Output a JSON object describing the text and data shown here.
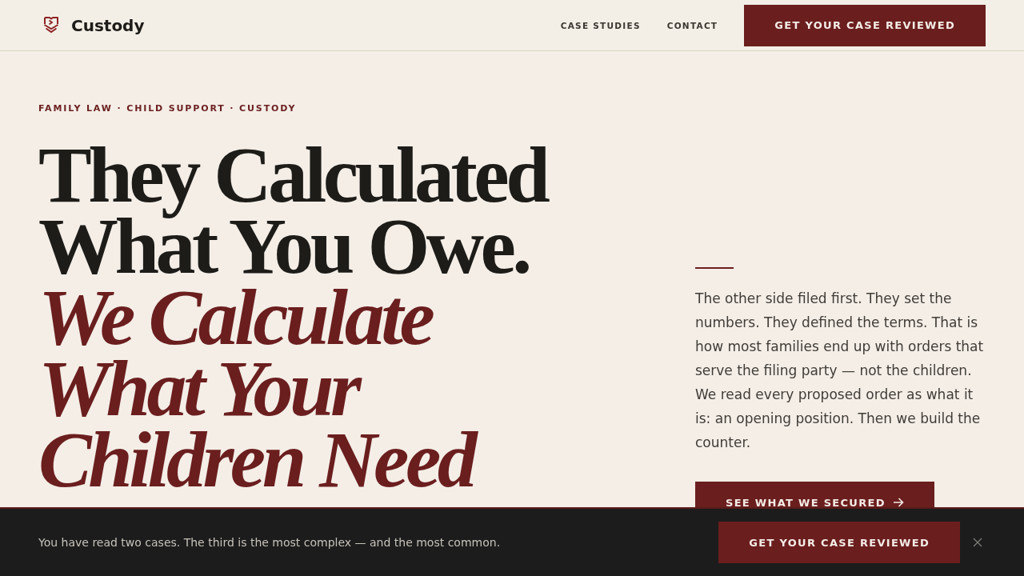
{
  "header": {
    "logo": "Custody",
    "nav": [
      {
        "label": "CASE STUDIES"
      },
      {
        "label": "CONTACT"
      }
    ],
    "cta": "GET YOUR CASE REVIEWED"
  },
  "hero": {
    "eyebrow": "FAMILY LAW · CHILD SUPPORT · CUSTODY",
    "headline": "They Calculated What You Owe. *We Calculate What Your Children Need*",
    "body": "The other side filed first. They set the numbers. They defined the terms. That is how most families end up with orders that serve the filing party — not the children. We read every proposed order as what it is: an opening position. Then we build the counter.",
    "cta": "SEE WHAT WE SECURED"
  },
  "banner": {
    "message": "You have read two cases. The third is the most complex — and the most common.",
    "cta": "GET YOUR CASE REVIEWED"
  }
}
